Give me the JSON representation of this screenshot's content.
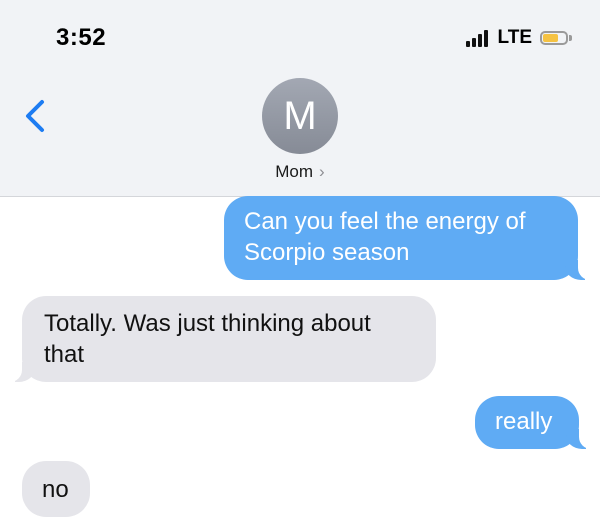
{
  "status_bar": {
    "time": "3:52",
    "network": "LTE",
    "signal_bars_active": 4,
    "battery_level": 0.7,
    "battery_color": "#f5c242"
  },
  "conversation": {
    "contact_initial": "M",
    "contact_name": "Mom",
    "contact_chevron": "›",
    "back_icon": "chevron-left-icon"
  },
  "messages": [
    {
      "direction": "outgoing",
      "text": "Can you feel the energy of Scorpio season"
    },
    {
      "direction": "incoming",
      "text": "Totally.  Was just thinking about that"
    },
    {
      "direction": "outgoing",
      "text": "really"
    },
    {
      "direction": "incoming",
      "text": "no"
    }
  ],
  "colors": {
    "outgoing_bubble": "#5fabf4",
    "incoming_bubble": "#e5e5ea",
    "accent": "#1d7cf2",
    "header_bg": "#f1f3f6"
  }
}
